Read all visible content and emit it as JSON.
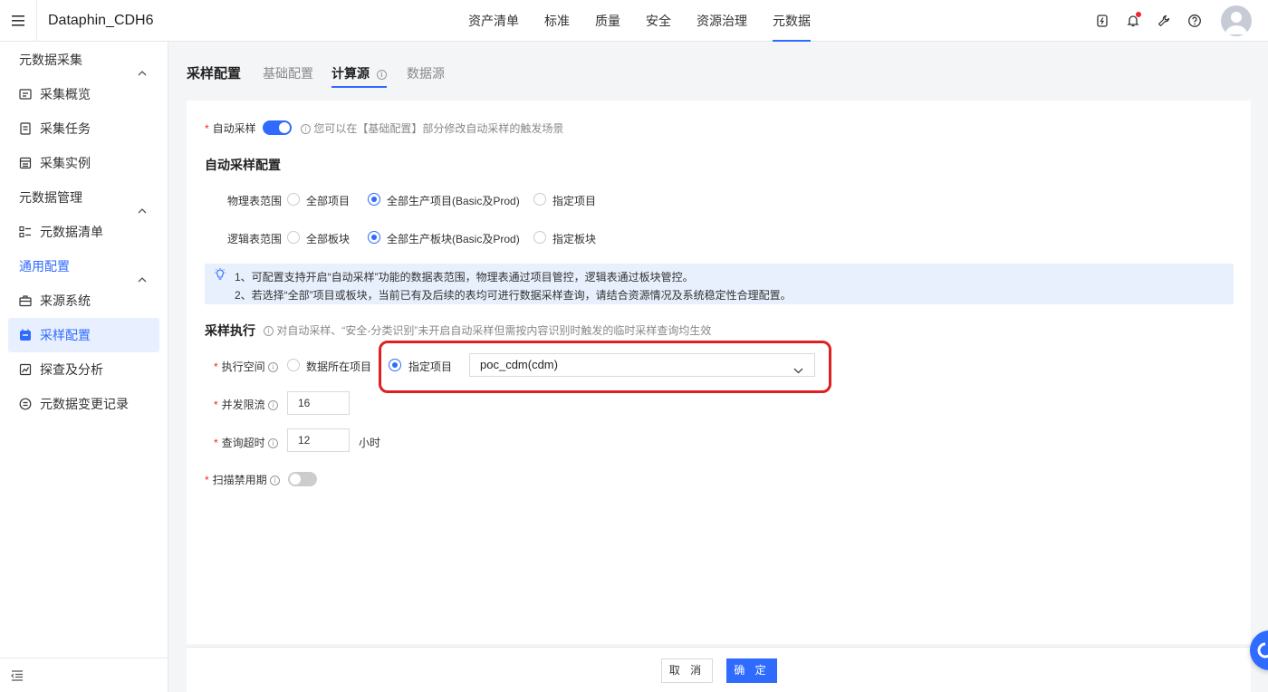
{
  "app": {
    "title": "Dataphin_CDH6"
  },
  "topnav": [
    {
      "label": "资产清单",
      "active": false
    },
    {
      "label": "标准",
      "active": false
    },
    {
      "label": "质量",
      "active": false
    },
    {
      "label": "安全",
      "active": false
    },
    {
      "label": "资源治理",
      "active": false
    },
    {
      "label": "元数据",
      "active": true
    }
  ],
  "sidebar": {
    "groups": [
      {
        "title": "元数据采集",
        "items": [
          "采集概览",
          "采集任务",
          "采集实例"
        ]
      },
      {
        "title": "元数据管理",
        "items": [
          "元数据清单"
        ]
      },
      {
        "title": "通用配置",
        "items": [
          "来源系统",
          "采样配置",
          "探查及分析",
          "元数据变更记录"
        ]
      }
    ],
    "active_item": "采样配置"
  },
  "page": {
    "title": "采样配置",
    "tabs": [
      {
        "label": "基础配置",
        "active": false
      },
      {
        "label": "计算源",
        "active": true
      },
      {
        "label": "数据源",
        "active": false
      }
    ]
  },
  "form": {
    "auto_sample": {
      "label": "自动采样",
      "enabled": true,
      "hint": "您可以在【基础配置】部分修改自动采样的触发场景"
    },
    "auto_config_title": "自动采样配置",
    "physical_scope": {
      "label": "物理表范围",
      "options": [
        "全部项目",
        "全部生产项目(Basic及Prod)",
        "指定项目"
      ],
      "selected": "全部生产项目(Basic及Prod)"
    },
    "logical_scope": {
      "label": "逻辑表范围",
      "options": [
        "全部板块",
        "全部生产板块(Basic及Prod)",
        "指定板块"
      ],
      "selected": "全部生产板块(Basic及Prod)"
    },
    "tips": [
      "1、可配置支持开启“自动采样”功能的数据表范围，物理表通过项目管控，逻辑表通过板块管控。",
      "2、若选择“全部”项目或板块，当前已有及后续的表均可进行数据采样查询，请结合资源情况及系统稳定性合理配置。"
    ],
    "exec_section": {
      "title": "采样执行",
      "hint": "对自动采样、“安全-分类识别”未开启自动采样但需按内容识别时触发的临时采样查询均生效"
    },
    "exec_space": {
      "label": "执行空间",
      "options": [
        "数据所在项目",
        "指定项目"
      ],
      "selected": "指定项目",
      "project_value": "poc_cdm(cdm)"
    },
    "concurrency": {
      "label": "并发限流",
      "value": "16"
    },
    "timeout": {
      "label": "查询超时",
      "value": "12",
      "unit": "小时"
    },
    "scan_disable": {
      "label": "扫描禁用期",
      "enabled": false
    }
  },
  "footer": {
    "cancel_label": "取 消",
    "ok_label": "确 定"
  },
  "colors": {
    "accent": "#2f6bff",
    "required": "#f5222d",
    "highlight": "#e02020"
  }
}
